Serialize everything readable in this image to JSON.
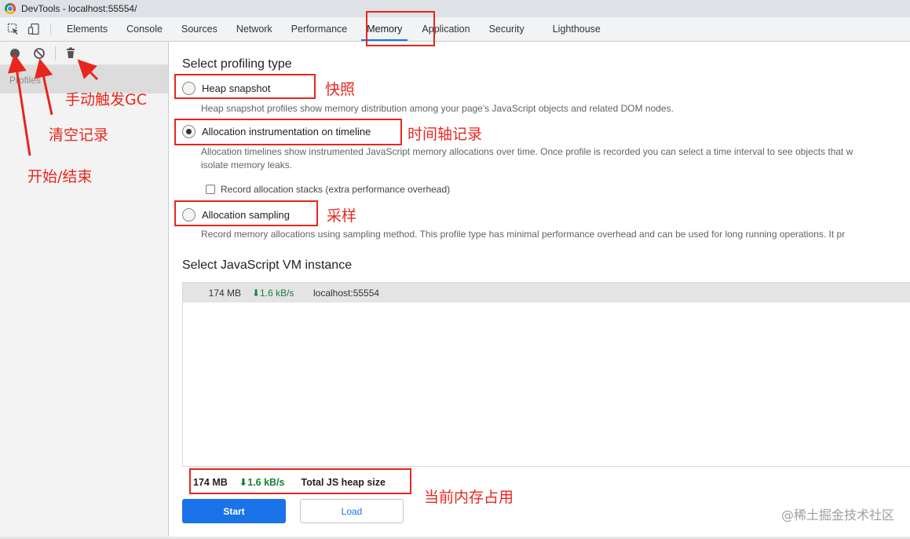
{
  "window": {
    "title": "DevTools - localhost:55554/"
  },
  "tabs": [
    {
      "label": "Elements"
    },
    {
      "label": "Console"
    },
    {
      "label": "Sources"
    },
    {
      "label": "Network"
    },
    {
      "label": "Performance"
    },
    {
      "label": "Memory",
      "active": true
    },
    {
      "label": "Application"
    },
    {
      "label": "Security"
    },
    {
      "label": "Lighthouse"
    }
  ],
  "sidebar": {
    "profiles_label": "Profiles"
  },
  "main": {
    "profiling_title": "Select profiling type",
    "options": [
      {
        "label": "Heap snapshot",
        "checked": false,
        "description": "Heap snapshot profiles show memory distribution among your page's JavaScript objects and related DOM nodes."
      },
      {
        "label": "Allocation instrumentation on timeline",
        "checked": true,
        "description_line1": "Allocation timelines show instrumented JavaScript memory allocations over time. Once profile is recorded you can select a time interval to see objects that w",
        "description_line2": "isolate memory leaks."
      },
      {
        "label": "Allocation sampling",
        "checked": false,
        "description": "Record memory allocations using sampling method. This profile type has minimal performance overhead and can be used for long running operations. It pr"
      }
    ],
    "record_stacks_label": "Record allocation stacks (extra performance overhead)",
    "vm_title": "Select JavaScript VM instance",
    "vm_instances": [
      {
        "size": "174 MB",
        "rate": "⬇1.6 kB/s",
        "host": "localhost:55554"
      }
    ],
    "footer": {
      "size": "174 MB",
      "rate": "⬇1.6 kB/s",
      "label": "Total JS heap size"
    },
    "start_label": "Start",
    "load_label": "Load"
  },
  "annotations": {
    "gc": "手动触发GC",
    "clear": "清空记录",
    "start_stop": "开始/结束",
    "snapshot": "快照",
    "timeline": "时间轴记录",
    "sampling": "采样",
    "current_usage": "当前内存占用"
  },
  "watermark": "@稀土掘金技术社区",
  "colors": {
    "accent": "#1a73e8",
    "annotation": "#e8261d",
    "rate_green": "#188038"
  }
}
